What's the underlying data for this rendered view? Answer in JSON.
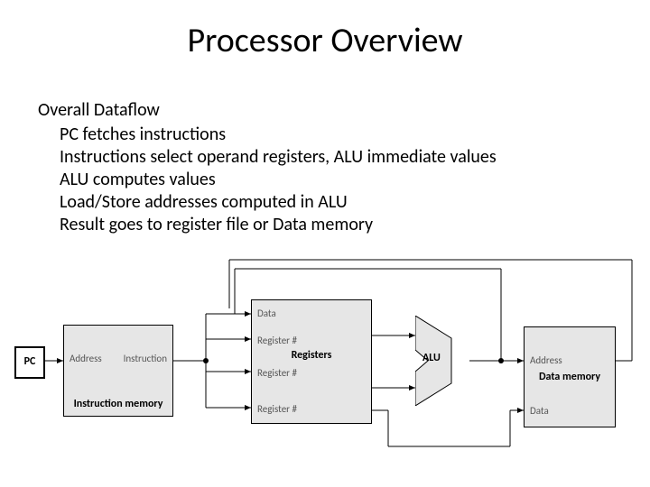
{
  "title": "Processor Overview",
  "subtitle": "Overall Dataflow",
  "bullets": [
    "PC fetches instructions",
    "Instructions select operand registers, ALU immediate values",
    "ALU computes values",
    "Load/Store addresses computed in ALU",
    "Result goes to register file or Data memory"
  ],
  "blocks": {
    "pc": "PC",
    "imem": "Instruction memory",
    "registers": "Registers",
    "alu": "ALU",
    "dmem": "Data memory"
  },
  "signals": {
    "address_imem": "Address",
    "instruction": "Instruction",
    "data_in": "Data",
    "reg1": "Register #",
    "reg2": "Register #",
    "reg3": "Register #",
    "address_dmem": "Address",
    "data_out": "Data"
  }
}
